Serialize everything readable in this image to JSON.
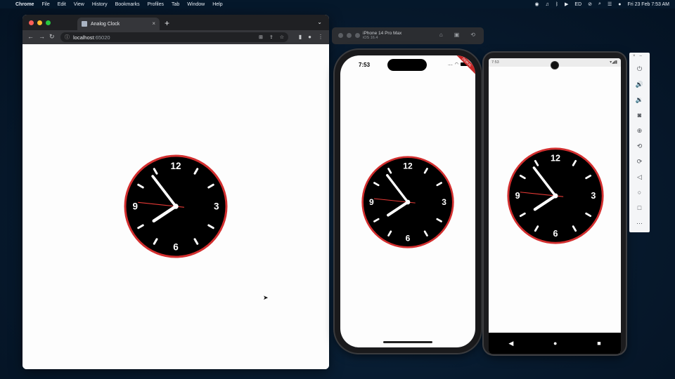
{
  "menubar": {
    "apple_icon": "apple-icon",
    "app_name": "Chrome",
    "items": [
      "File",
      "Edit",
      "View",
      "History",
      "Bookmarks",
      "Profiles",
      "Tab",
      "Window",
      "Help"
    ],
    "battery": "ED",
    "datetime": "Fri 23 Feb  7:53 AM"
  },
  "browser": {
    "tab_title": "Analog Clock",
    "url_host": "localhost",
    "url_port": ":65020"
  },
  "simulator": {
    "device_name": "iPhone 14 Pro Max",
    "os": "iOS 16.4"
  },
  "iphone": {
    "time": "7:53",
    "signal": "....",
    "debug_label": "DEBUG"
  },
  "android": {
    "time": "7:53"
  },
  "clock": {
    "numerals": [
      "12",
      "3",
      "6",
      "9"
    ],
    "hour": 7,
    "minute": 53,
    "second": 46,
    "face_color": "#000000",
    "rim_color": "#d32f2f",
    "hand_color": "#ffffff",
    "second_hand_color": "#e53935"
  },
  "colors": {
    "desktop": "#0a2136",
    "page_bg": "#fdfdfd"
  }
}
